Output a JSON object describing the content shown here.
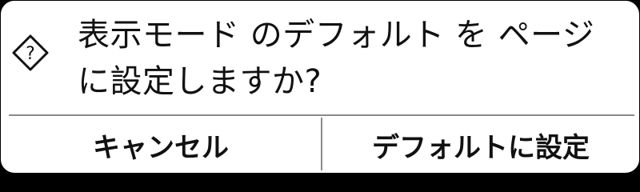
{
  "dialog": {
    "icon": "question-diamond-icon",
    "message": "表示モード のデフォルト を ページ\nに設定しますか?",
    "buttons": {
      "cancel_label": "キャンセル",
      "confirm_label": "デフォルトに設定"
    }
  },
  "colors": {
    "background": "#000000",
    "dialog_bg": "#ffffff",
    "text": "#111111",
    "divider": "#8a8a8a"
  }
}
